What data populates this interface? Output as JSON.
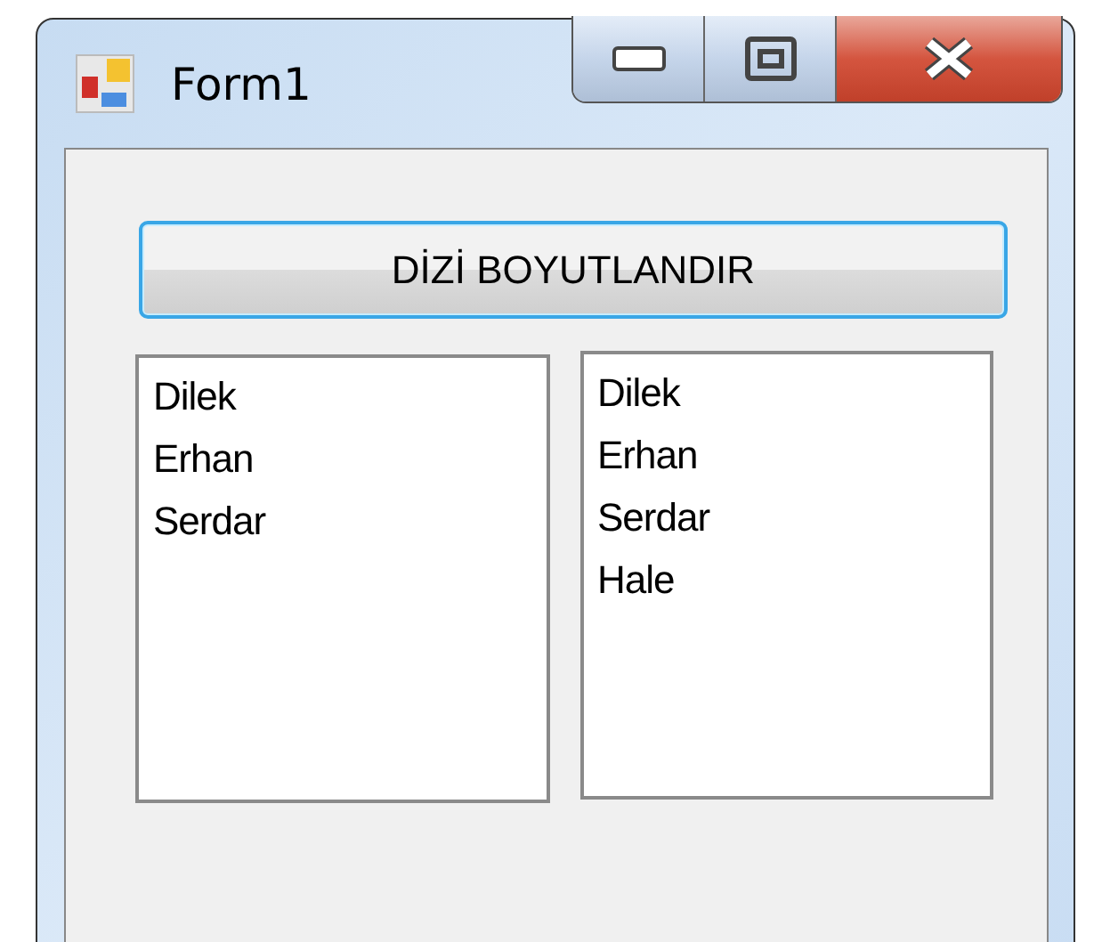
{
  "window": {
    "title": "Form1"
  },
  "button": {
    "label": "DİZİ BOYUTLANDIR",
    "focused": true
  },
  "lists": [
    {
      "items": [
        "Dilek",
        "Erhan",
        "Serdar"
      ]
    },
    {
      "items": [
        "Dilek",
        "Erhan",
        "Serdar",
        "Hale"
      ]
    }
  ]
}
